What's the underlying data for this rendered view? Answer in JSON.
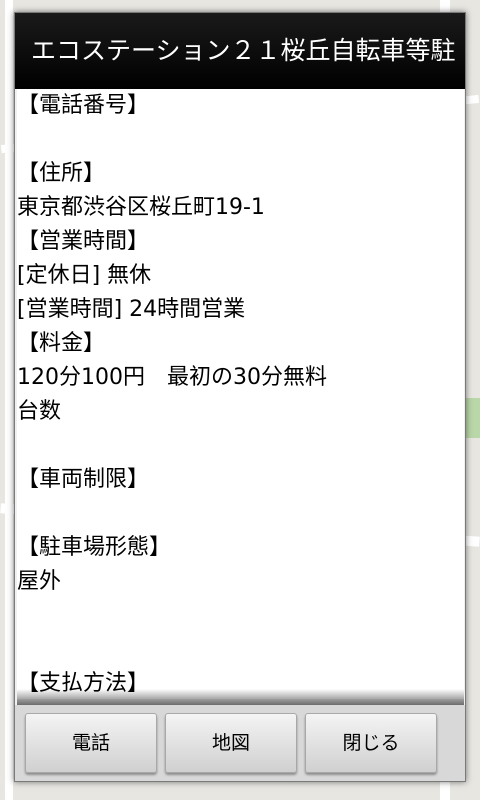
{
  "dialog": {
    "title": "エコステーション２１桜丘自転車等駐",
    "content_lines": [
      "【電話番号】",
      "",
      "【住所】",
      "東京都渋谷区桜丘町19-1",
      "【営業時間】",
      "[定休日] 無休",
      "[営業時間] 24時間営業",
      "【料金】",
      "120分100円　最初の30分無料",
      "台数",
      "",
      "【車両制限】",
      "",
      "【駐車場形態】",
      "屋外",
      "",
      "",
      "【支払方法】"
    ]
  },
  "buttons": {
    "call": "電話",
    "map": "地図",
    "close": "閉じる"
  }
}
